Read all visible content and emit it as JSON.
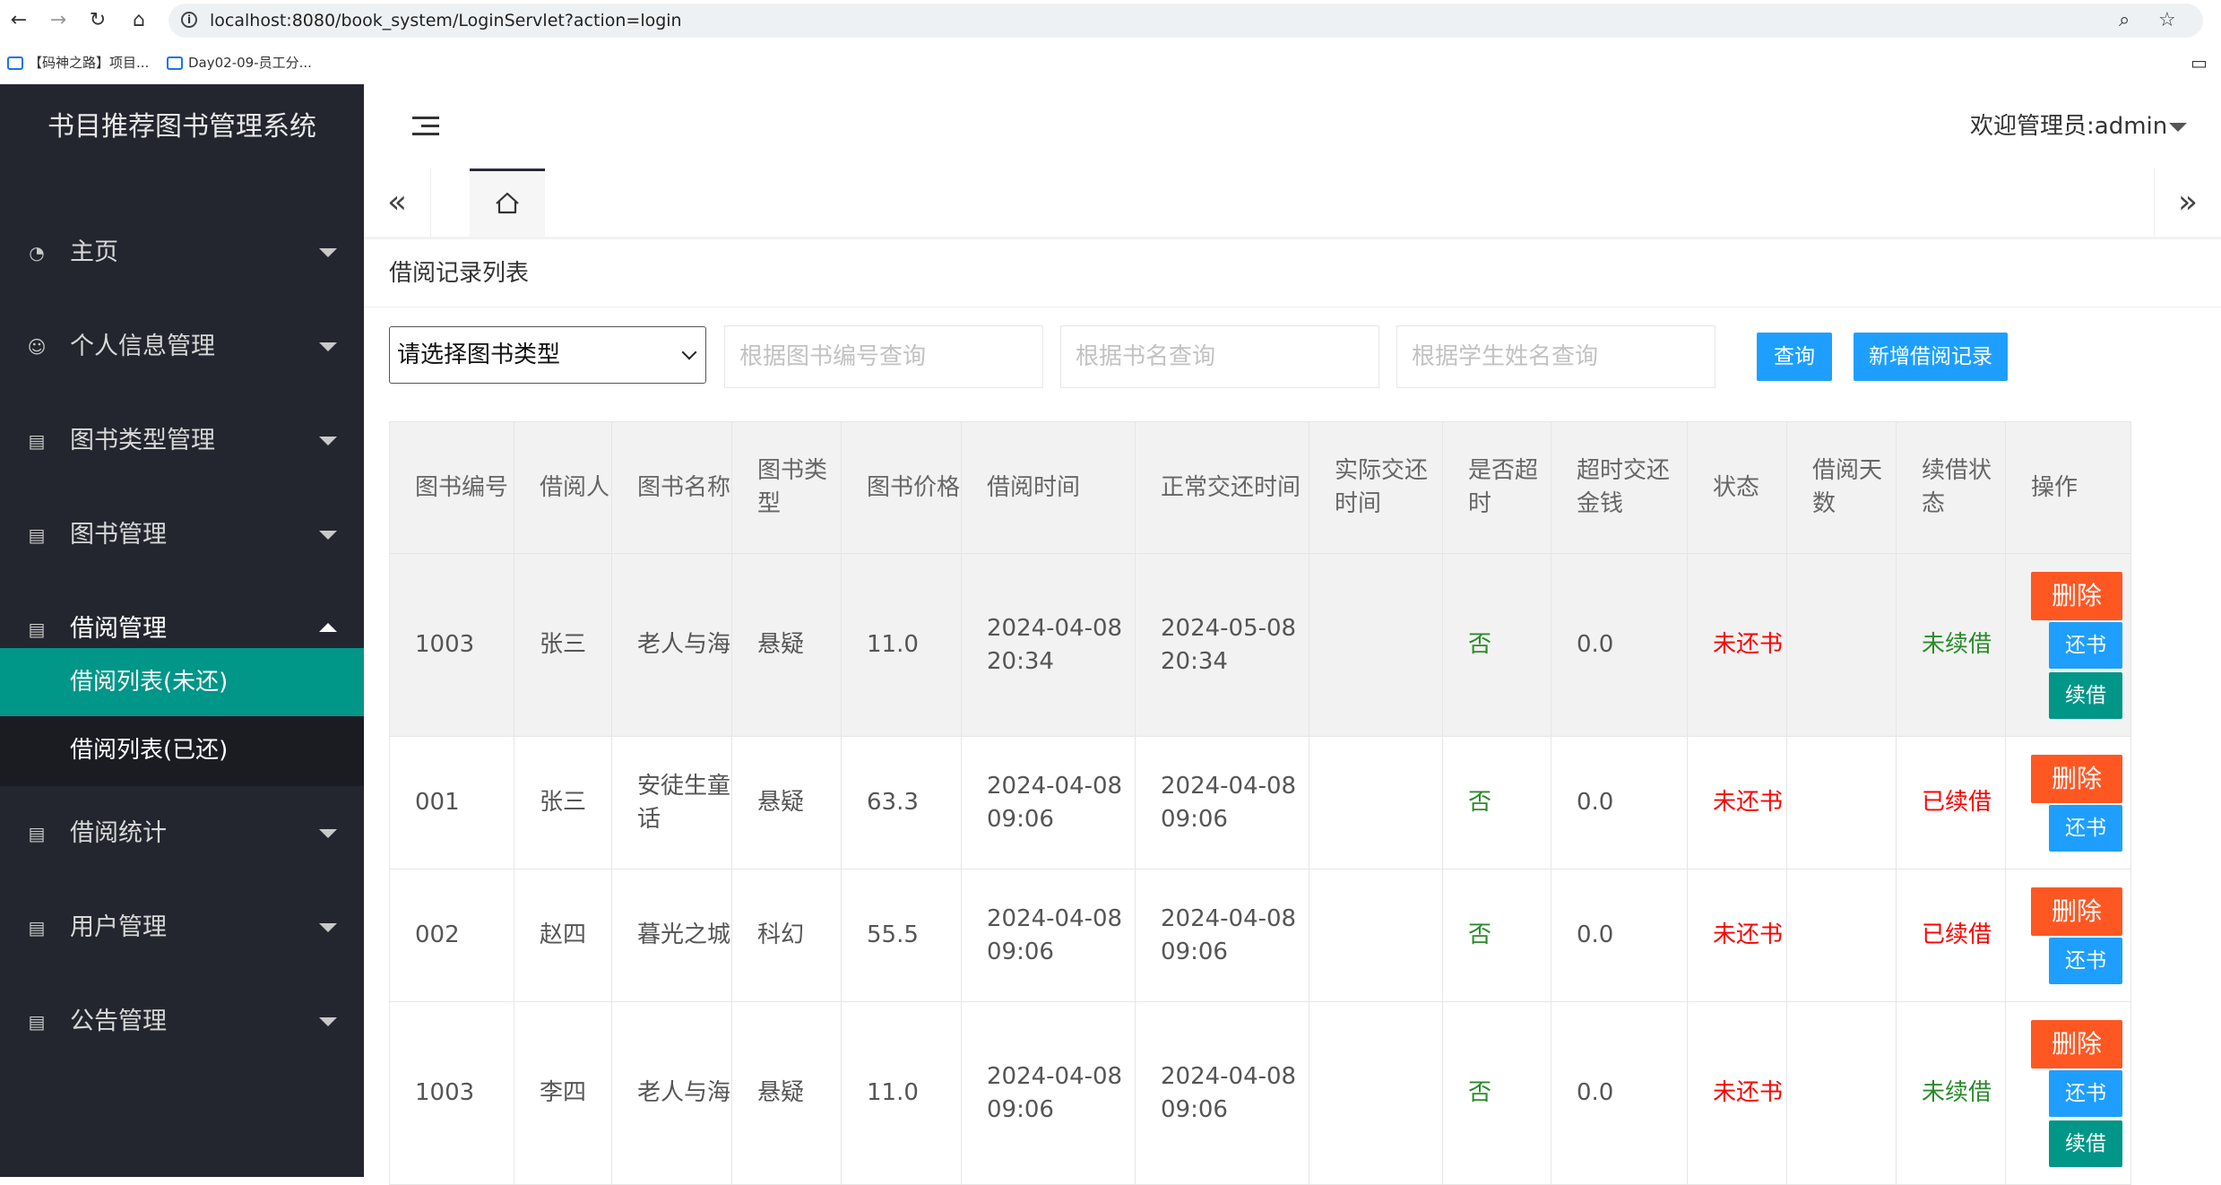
{
  "browser": {
    "url": "localhost:8080/book_system/LoginServlet?action=login",
    "bookmarks": [
      "【码神之路】项目...",
      "Day02-09-员工分..."
    ]
  },
  "sidebar": {
    "logo": "书目推荐图书管理系统",
    "items": [
      {
        "label": "主页",
        "icon": "dashboard-icon"
      },
      {
        "label": "个人信息管理",
        "icon": "user-icon"
      },
      {
        "label": "图书类型管理",
        "icon": "document-icon"
      },
      {
        "label": "图书管理",
        "icon": "document-icon"
      },
      {
        "label": "借阅管理",
        "icon": "document-icon"
      },
      {
        "label": "借阅统计",
        "icon": "document-icon"
      },
      {
        "label": "用户管理",
        "icon": "document-icon"
      },
      {
        "label": "公告管理",
        "icon": "document-icon"
      }
    ],
    "subitems": [
      "借阅列表(未还)",
      "借阅列表(已还)"
    ]
  },
  "header": {
    "welcome": "欢迎管理员:admin"
  },
  "main": {
    "title": "借阅记录列表",
    "filter": {
      "type_select": "请选择图书类型",
      "book_no_placeholder": "根据图书编号查询",
      "book_name_placeholder": "根据书名查询",
      "student_placeholder": "根据学生姓名查询",
      "query_btn": "查询",
      "add_btn": "新增借阅记录"
    },
    "table": {
      "headers": [
        "图书编号",
        "借阅人",
        "图书名称",
        "图书类型",
        "图书价格",
        "借阅时间",
        "正常交还时间",
        "实际交还时间",
        "是否超时",
        "超时交还金钱",
        "状态",
        "借阅天数",
        "续借状态",
        "操作"
      ],
      "rows": [
        {
          "no": "1003",
          "person": "张三",
          "name": "老人与海",
          "type": "悬疑",
          "price": "11.0",
          "borrow": "2024-04-08 20:34",
          "due": "2024-05-08 20:34",
          "actual": "",
          "overdue": "否",
          "fine": "0.0",
          "status": "未还书",
          "days": "",
          "renew": "未续借"
        },
        {
          "no": "001",
          "person": "张三",
          "name": "安徒生童话",
          "type": "悬疑",
          "price": "63.3",
          "borrow": "2024-04-08 09:06",
          "due": "2024-04-08 09:06",
          "actual": "",
          "overdue": "否",
          "fine": "0.0",
          "status": "未还书",
          "days": "",
          "renew": "已续借"
        },
        {
          "no": "002",
          "person": "赵四",
          "name": "暮光之城",
          "type": "科幻",
          "price": "55.5",
          "borrow": "2024-04-08 09:06",
          "due": "2024-04-08 09:06",
          "actual": "",
          "overdue": "否",
          "fine": "0.0",
          "status": "未还书",
          "days": "",
          "renew": "已续借"
        },
        {
          "no": "1003",
          "person": "李四",
          "name": "老人与海",
          "type": "悬疑",
          "price": "11.0",
          "borrow": "2024-04-08 09:06",
          "due": "2024-04-08 09:06",
          "actual": "",
          "overdue": "否",
          "fine": "0.0",
          "status": "未还书",
          "days": "",
          "renew": "未续借"
        }
      ],
      "actions": {
        "delete": "删除",
        "return": "还书",
        "renew": "续借"
      }
    }
  },
  "colors": {
    "sidebar_bg": "#23262e",
    "active": "#009688",
    "blue": "#1e9fff",
    "orange": "#ff5722",
    "red": "#ff0000",
    "green": "#2a8a2a"
  }
}
